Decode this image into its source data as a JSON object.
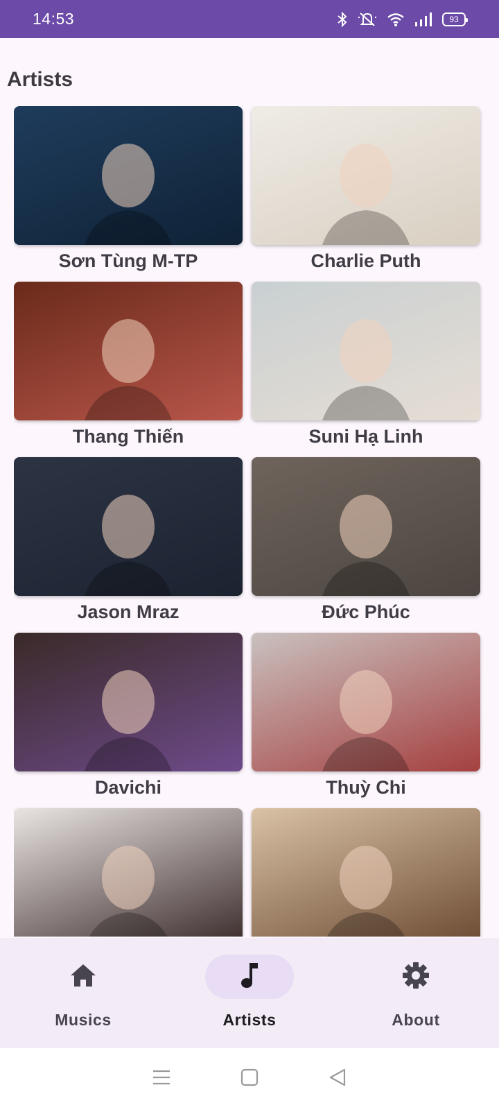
{
  "status_bar": {
    "time": "14:53",
    "battery": "93",
    "icons": [
      "bluetooth-icon",
      "mute-icon",
      "wifi-icon",
      "signal-icon",
      "battery-icon"
    ]
  },
  "page": {
    "title": "Artists"
  },
  "artists": [
    {
      "name": "Sơn Tùng M-TP",
      "image_colors": [
        "#1f3c5c",
        "#0f2236"
      ]
    },
    {
      "name": "Charlie Puth",
      "image_colors": [
        "#efece6",
        "#d9cfc2"
      ]
    },
    {
      "name": "Thang Thiến",
      "image_colors": [
        "#6a2a1a",
        "#b8564a"
      ]
    },
    {
      "name": "Suni Hạ Linh",
      "image_colors": [
        "#c9d0d2",
        "#e6ddd4"
      ]
    },
    {
      "name": "Jason Mraz",
      "image_colors": [
        "#2c3444",
        "#1c2230"
      ]
    },
    {
      "name": "Đức Phúc",
      "image_colors": [
        "#6e645c",
        "#4c4540"
      ]
    },
    {
      "name": "Davichi",
      "image_colors": [
        "#3a2a28",
        "#6e4a8a"
      ]
    },
    {
      "name": "Thuỳ Chi",
      "image_colors": [
        "#c9c1bf",
        "#a54040"
      ]
    },
    {
      "name": "",
      "image_colors": [
        "#e9e4e2",
        "#3a2a2a"
      ]
    },
    {
      "name": "",
      "image_colors": [
        "#d9c2a6",
        "#6b4a32"
      ]
    }
  ],
  "bottom_nav": {
    "items": [
      {
        "label": "Musics",
        "icon": "home-icon",
        "active": false
      },
      {
        "label": "Artists",
        "icon": "music-note-icon",
        "active": true
      },
      {
        "label": "About",
        "icon": "gear-icon",
        "active": false
      }
    ]
  },
  "system_nav": [
    "menu-icon",
    "home-square-icon",
    "back-icon"
  ],
  "colors": {
    "status_bar": "#6b4aa8",
    "background": "#fdf7fd",
    "nav_background": "#f3ecf6",
    "active_pill": "#e8ddf5"
  }
}
